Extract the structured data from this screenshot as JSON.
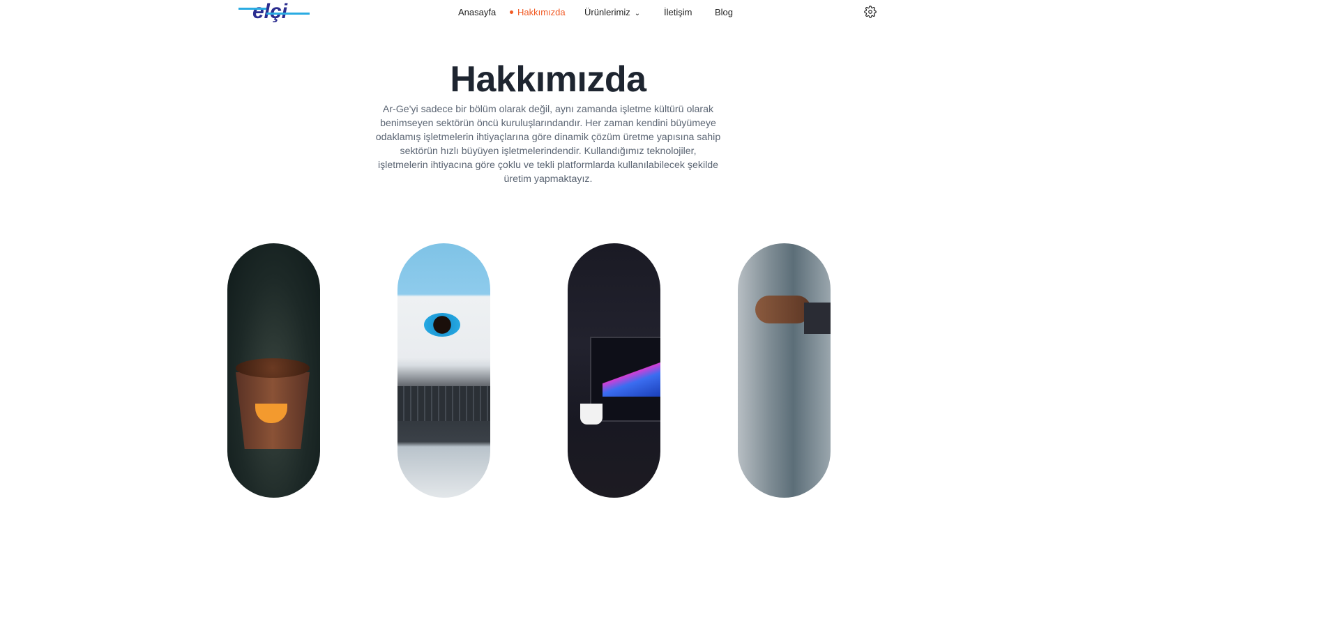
{
  "header": {
    "logo_text": "elçi",
    "nav": [
      {
        "label": "Anasayfa",
        "active": false
      },
      {
        "label": "Hakkımızda",
        "active": true
      },
      {
        "label": "Ürünlerimiz",
        "active": false,
        "has_dropdown": true
      },
      {
        "label": "İletişim",
        "active": false
      },
      {
        "label": "Blog",
        "active": false
      }
    ],
    "settings_icon": "gear-icon",
    "chevron": "⌄"
  },
  "colors": {
    "accent": "#f15a24",
    "heading": "#1e2530",
    "text": "#5b6573",
    "logo_blue": "#2b2d8f",
    "logo_cyan": "#29abe2"
  },
  "main": {
    "title": "Hakkımızda",
    "description": "Ar-Ge'yi sadece bir bölüm olarak değil, aynı zamanda işletme kültürü olarak benimseyen sektörün öncü kuruluşlarındandır. Her zaman kendini büyümeye odaklamış işletmelerin ihtiyaçlarına göre dinamik çözüm üretme yapısına sahip sektörün hızlı büyüyen işletmelerindendir. Kullandığımız teknolojiler, işletmelerin ihtiyacına göre çoklu ve tekli platformlarda kullanılabilecek şekilde üretim yapmaktayız."
  }
}
